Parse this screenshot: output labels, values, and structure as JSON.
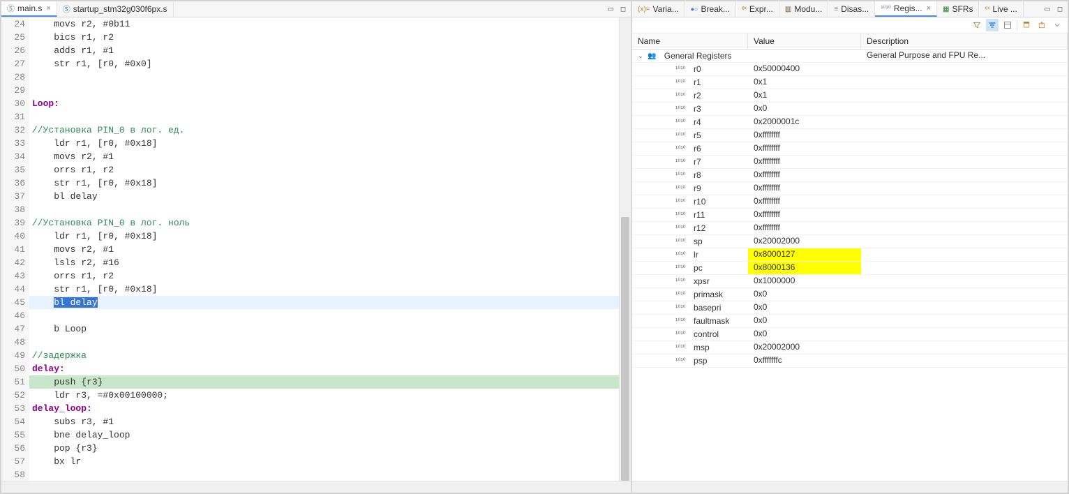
{
  "editor": {
    "tabs": [
      {
        "label": "main.s",
        "icon": "S-file-icon",
        "active": true,
        "closeable": true
      },
      {
        "label": "startup_stm32g030f6px.s",
        "icon": "S-file-icon",
        "active": false,
        "closeable": false
      }
    ],
    "lines": [
      {
        "n": 24,
        "t": "    movs r2, #0b11"
      },
      {
        "n": 25,
        "t": "    bics r1, r2"
      },
      {
        "n": 26,
        "t": "    adds r1, #1"
      },
      {
        "n": 27,
        "t": "    str r1, [r0, #0x0]"
      },
      {
        "n": 28,
        "t": ""
      },
      {
        "n": 29,
        "t": ""
      },
      {
        "n": 30,
        "t": "Loop:",
        "label": true
      },
      {
        "n": 31,
        "t": ""
      },
      {
        "n": 32,
        "t": "//Установка PIN_0 в лог. ед.",
        "comment": true
      },
      {
        "n": 33,
        "t": "    ldr r1, [r0, #0x18]"
      },
      {
        "n": 34,
        "t": "    movs r2, #1"
      },
      {
        "n": 35,
        "t": "    orrs r1, r2"
      },
      {
        "n": 36,
        "t": "    str r1, [r0, #0x18]"
      },
      {
        "n": 37,
        "t": "    bl delay"
      },
      {
        "n": 38,
        "t": ""
      },
      {
        "n": 39,
        "t": "//Установка PIN_0 в лог. ноль",
        "comment": true
      },
      {
        "n": 40,
        "t": "    ldr r1, [r0, #0x18]"
      },
      {
        "n": 41,
        "t": "    movs r2, #1"
      },
      {
        "n": 42,
        "t": "    lsls r2, #16"
      },
      {
        "n": 43,
        "t": "    orrs r1, r2"
      },
      {
        "n": 44,
        "t": "    str r1, [r0, #0x18]"
      },
      {
        "n": 45,
        "t": "    bl delay",
        "current": true,
        "hl": "bl delay"
      },
      {
        "n": 46,
        "t": ""
      },
      {
        "n": 47,
        "t": "    b Loop"
      },
      {
        "n": 48,
        "t": ""
      },
      {
        "n": 49,
        "t": "//задержка",
        "comment": true
      },
      {
        "n": 50,
        "t": "delay:",
        "label": true
      },
      {
        "n": 51,
        "t": "    push {r3}",
        "step": true
      },
      {
        "n": 52,
        "t": "    ldr r3, =#0x00100000;"
      },
      {
        "n": 53,
        "t": "delay_loop:",
        "label": true
      },
      {
        "n": 54,
        "t": "    subs r3, #1"
      },
      {
        "n": 55,
        "t": "    bne delay_loop"
      },
      {
        "n": 56,
        "t": "    pop {r3}"
      },
      {
        "n": 57,
        "t": "    bx lr"
      },
      {
        "n": 58,
        "t": ""
      }
    ],
    "scroll_thumb": {
      "top_pct": 43,
      "height_pct": 57
    }
  },
  "right": {
    "tabs": [
      {
        "label": "Varia...",
        "icon": "var"
      },
      {
        "label": "Break...",
        "icon": "bp"
      },
      {
        "label": "Expr...",
        "icon": "expr"
      },
      {
        "label": "Modu...",
        "icon": "mod"
      },
      {
        "label": "Disas...",
        "icon": "dis"
      },
      {
        "label": "Regis...",
        "icon": "reg",
        "active": true,
        "closeable": true
      },
      {
        "label": "SFRs",
        "icon": "sfr"
      },
      {
        "label": "Live ...",
        "icon": "live"
      }
    ],
    "toolbar_icons": [
      "filter-icon",
      "tree-filter-icon",
      "layout-icon",
      "sep",
      "pin-icon",
      "export-icon",
      "menu-icon"
    ],
    "columns": {
      "name": "Name",
      "value": "Value",
      "description": "Description"
    },
    "group": {
      "label": "General Registers",
      "desc": "General Purpose and FPU Re..."
    },
    "registers": [
      {
        "name": "r0",
        "value": "0x50000400"
      },
      {
        "name": "r1",
        "value": "0x1"
      },
      {
        "name": "r2",
        "value": "0x1"
      },
      {
        "name": "r3",
        "value": "0x0"
      },
      {
        "name": "r4",
        "value": "0x2000001c"
      },
      {
        "name": "r5",
        "value": "0xffffffff"
      },
      {
        "name": "r6",
        "value": "0xffffffff"
      },
      {
        "name": "r7",
        "value": "0xffffffff"
      },
      {
        "name": "r8",
        "value": "0xffffffff"
      },
      {
        "name": "r9",
        "value": "0xffffffff"
      },
      {
        "name": "r10",
        "value": "0xffffffff"
      },
      {
        "name": "r11",
        "value": "0xffffffff"
      },
      {
        "name": "r12",
        "value": "0xffffffff"
      },
      {
        "name": "sp",
        "value": "0x20002000"
      },
      {
        "name": "lr",
        "value": "0x8000127",
        "changed": true
      },
      {
        "name": "pc",
        "value": "0x8000136",
        "changed": true
      },
      {
        "name": "xpsr",
        "value": "0x1000000"
      },
      {
        "name": "primask",
        "value": "0x0"
      },
      {
        "name": "basepri",
        "value": "0x0"
      },
      {
        "name": "faultmask",
        "value": "0x0"
      },
      {
        "name": "control",
        "value": "0x0"
      },
      {
        "name": "msp",
        "value": "0x20002000"
      },
      {
        "name": "psp",
        "value": "0xfffffffc"
      }
    ]
  }
}
